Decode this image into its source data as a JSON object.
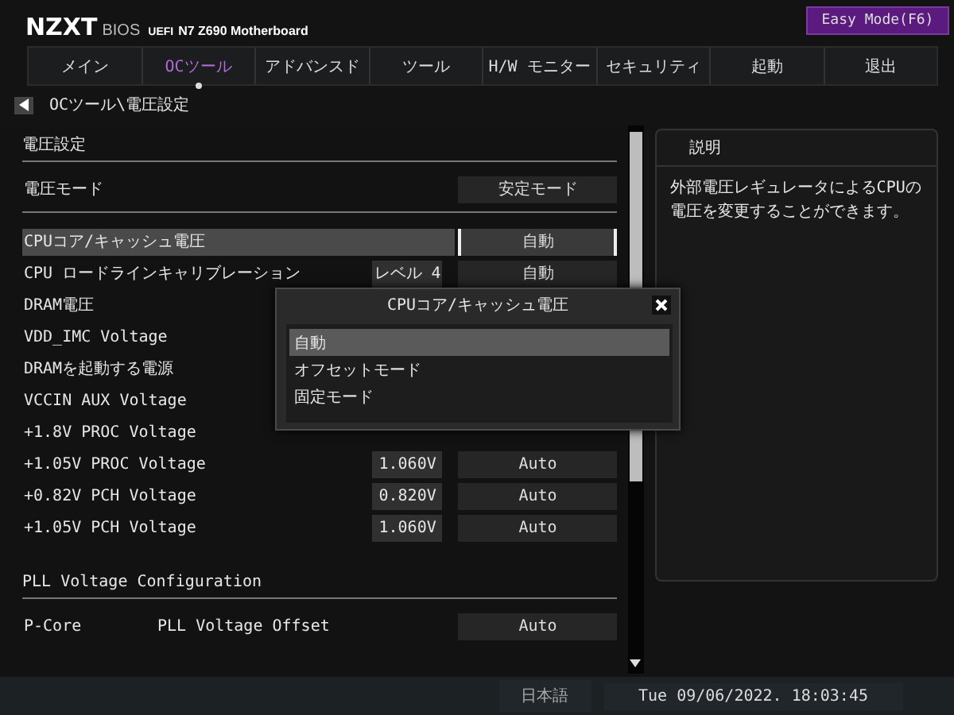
{
  "header": {
    "brand": "NZXT",
    "bios": "BIOS",
    "uefi": "UEFI",
    "model": "N7 Z690 Motherboard",
    "mode_button": "Easy Mode(F6)"
  },
  "tabs": [
    {
      "label": "メイン",
      "selected": false
    },
    {
      "label": "OCツール",
      "selected": true
    },
    {
      "label": "アドバンスド",
      "selected": false
    },
    {
      "label": "ツール",
      "selected": false
    },
    {
      "label": "H/W モニター",
      "selected": false
    },
    {
      "label": "セキュリティ",
      "selected": false
    },
    {
      "label": "起動",
      "selected": false
    },
    {
      "label": "退出",
      "selected": false
    }
  ],
  "breadcrumb": "OCツール\\電圧設定",
  "settings": [
    {
      "kind": "heading",
      "label": "電圧設定"
    },
    {
      "kind": "row",
      "label": "電圧モード",
      "setting": "安定モード",
      "selected": false
    },
    {
      "kind": "rule"
    },
    {
      "kind": "row",
      "label": "CPUコア/キャッシュ電圧",
      "setting": "自動",
      "selected": true
    },
    {
      "kind": "row",
      "label": "CPU ロードラインキャリブレーション",
      "value": "レベル 4",
      "setting": "自動",
      "selected": false
    },
    {
      "kind": "row",
      "label": "DRAM電圧",
      "selected": false
    },
    {
      "kind": "row",
      "label": "VDD_IMC Voltage",
      "selected": false
    },
    {
      "kind": "row",
      "label": "DRAMを起動する電源",
      "selected": false
    },
    {
      "kind": "row",
      "label": "VCCIN AUX Voltage",
      "selected": false
    },
    {
      "kind": "row",
      "label": "+1.8V PROC Voltage",
      "selected": false
    },
    {
      "kind": "row",
      "label": "+1.05V PROC Voltage",
      "value": "1.060V",
      "setting": "Auto",
      "selected": false
    },
    {
      "kind": "row",
      "label": "+0.82V PCH Voltage",
      "value": "0.820V",
      "setting": "Auto",
      "selected": false
    },
    {
      "kind": "row",
      "label": "+1.05V PCH Voltage",
      "value": "1.060V",
      "setting": "Auto",
      "selected": false
    },
    {
      "kind": "gap"
    },
    {
      "kind": "heading",
      "label": "PLL Voltage Configuration"
    },
    {
      "kind": "row",
      "label": "P-Core",
      "sublabel": "PLL Voltage Offset",
      "setting": "Auto",
      "selected": false
    }
  ],
  "help": {
    "title": "説明",
    "text": "外部電圧レギュレータによるCPUの電圧を変更することができます。"
  },
  "dialog": {
    "title": "CPUコア/キャッシュ電圧",
    "options": [
      {
        "label": "自動",
        "selected": true
      },
      {
        "label": "オフセットモード",
        "selected": false
      },
      {
        "label": "固定モード",
        "selected": false
      }
    ]
  },
  "status_bar": {
    "language": "日本語",
    "datetime": "Tue 09/06/2022. 18:03:45"
  }
}
